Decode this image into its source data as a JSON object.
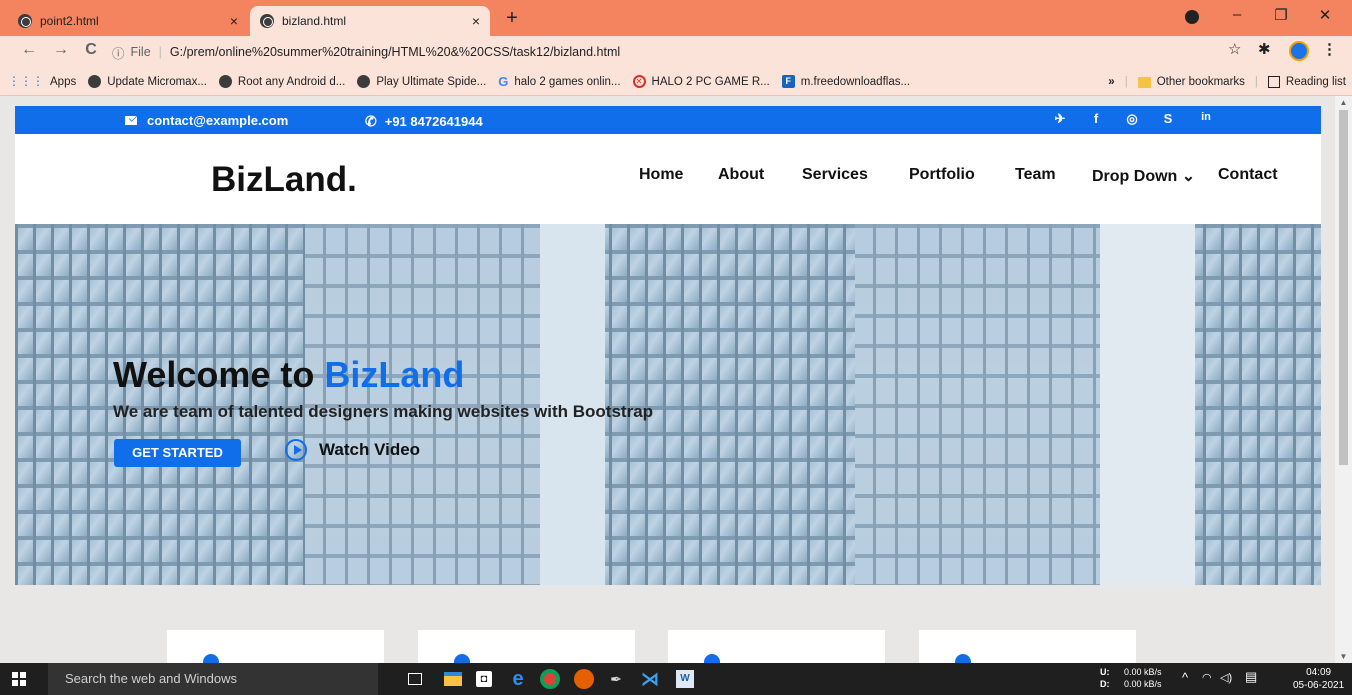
{
  "browser": {
    "tabs": [
      {
        "title": "point2.html",
        "close": "×"
      },
      {
        "title": "bizland.html",
        "close": "×"
      }
    ],
    "new_tab": "+",
    "window_controls": {
      "minimize": "–",
      "restore": "❐",
      "close": "✕"
    },
    "address": {
      "info": "ⓘ",
      "scheme": "File",
      "url": "G:/prem/online%20summer%20training/HTML%20&%20CSS/task12/bizland.html"
    },
    "nav": {
      "back": "←",
      "forward": "→",
      "reload": "C"
    },
    "actions": {
      "star": "☆",
      "extensions": "✱",
      "menu": "⋮"
    },
    "bookmarks": [
      {
        "label": "Apps",
        "icon": "apps-grid-icon"
      },
      {
        "label": "Update Micromax...",
        "icon": "globe-icon"
      },
      {
        "label": "Root any Android d...",
        "icon": "globe-icon"
      },
      {
        "label": "Play Ultimate Spide...",
        "icon": "globe-icon"
      },
      {
        "label": "halo 2 games onlin...",
        "icon": "google-icon"
      },
      {
        "label": "HALO 2 PC GAME R...",
        "icon": "halo-icon"
      },
      {
        "label": "m.freedownloadflas...",
        "icon": "f-icon"
      }
    ],
    "bookmarks_overflow": "»",
    "other_bookmarks": "Other bookmarks",
    "reading_list": "Reading list"
  },
  "site": {
    "email": "contact@example.com",
    "phone": "+91 8472641944",
    "social": [
      {
        "name": "twitter-icon",
        "glyph": "🐦"
      },
      {
        "name": "facebook-icon",
        "glyph": "f"
      },
      {
        "name": "instagram-icon",
        "glyph": "◎"
      },
      {
        "name": "skype-icon",
        "glyph": "S"
      },
      {
        "name": "linkedin-icon",
        "glyph": "in"
      }
    ],
    "logo": "BizLand.",
    "nav": [
      "Home",
      "About",
      "Services",
      "Portfolio",
      "Team",
      "Drop Down ⌄",
      "Contact"
    ],
    "hero": {
      "title_prefix": "Welcome to ",
      "title_brand": "BizLand",
      "subtitle": "We are team of talented designers making websites with Bootstrap",
      "cta": "GET STARTED",
      "video": "Watch Video"
    },
    "colors": {
      "accent": "#106eea",
      "tab_bar": "#f4845f"
    }
  },
  "taskbar": {
    "search_placeholder": "Search the web and Windows",
    "net_labels": "U:\nD:",
    "net_speed_up": "0.00 kB/s",
    "net_speed_down": "0.00 kB/s",
    "time": "04:09",
    "date": "05-06-2021"
  }
}
